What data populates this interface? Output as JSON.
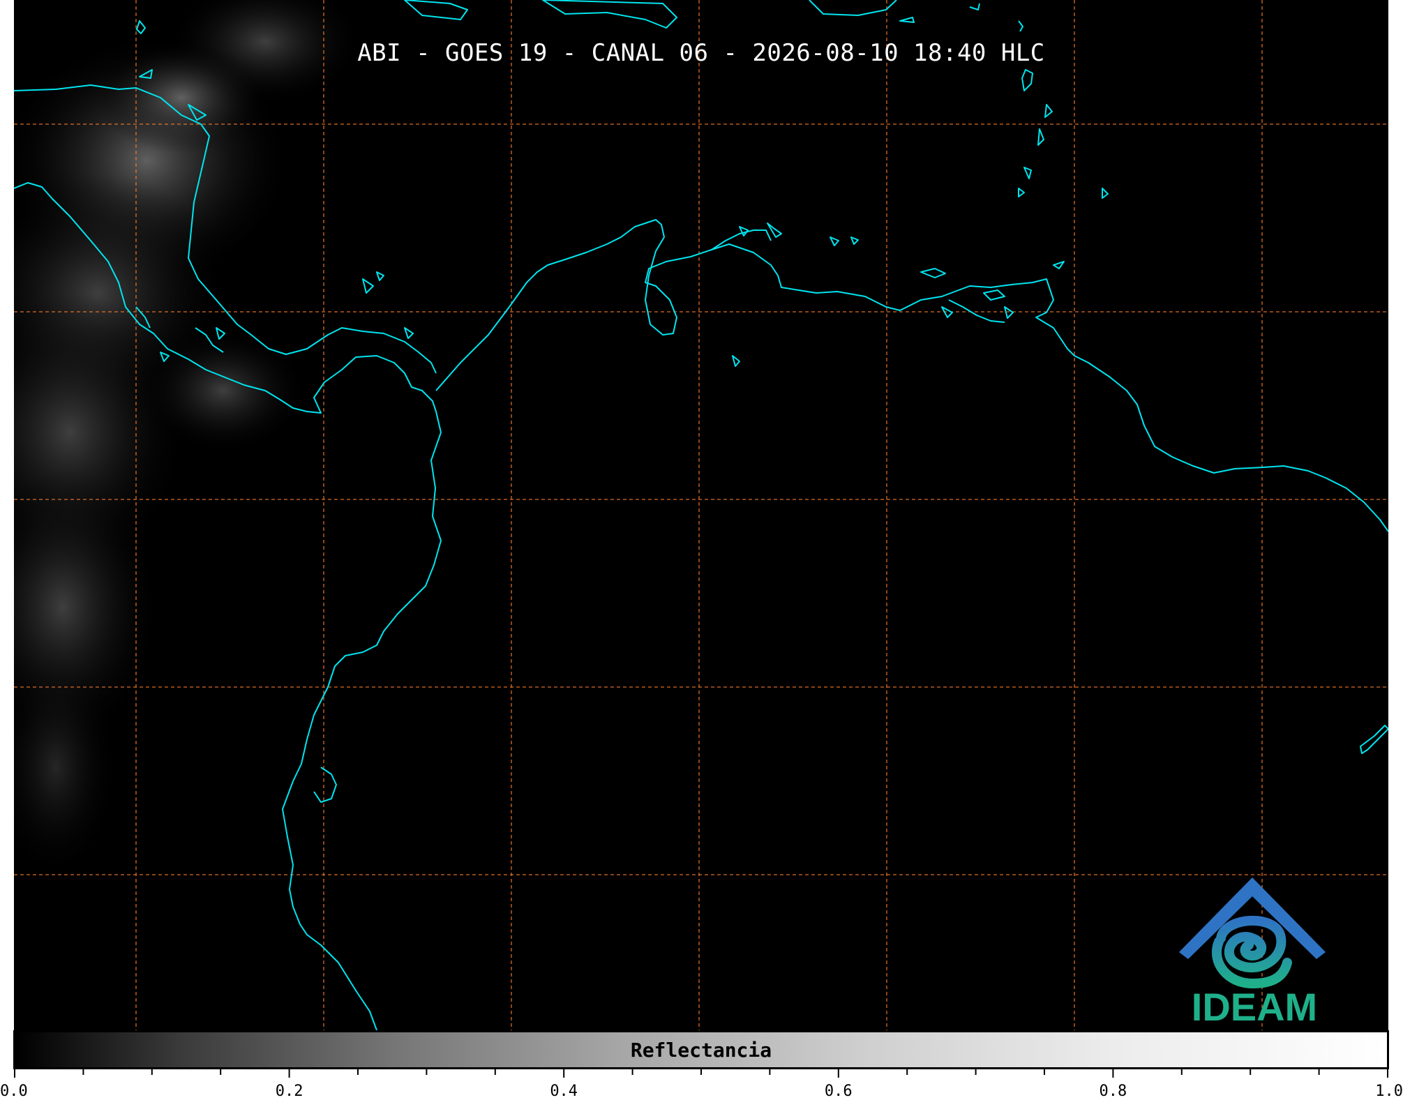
{
  "title": "ABI - GOES 19 - CANAL 06 - 2026-08-10 18:40 HLC",
  "logo": {
    "text": "IDEAM",
    "colors": [
      "#2a7ec0",
      "#1fb08a"
    ]
  },
  "colors": {
    "background": "#000000",
    "coastline": "#00e5ef",
    "gridlines": "#ff7f2a",
    "logo_blue": "#2a7ec0",
    "logo_green": "#1fb08a"
  },
  "colorbar": {
    "label": "Reflectancia",
    "min": 0.0,
    "max": 1.0,
    "tick_labels": [
      "0.0",
      "0.2",
      "0.4",
      "0.6",
      "0.8",
      "1.0"
    ],
    "colormap": "grayscale"
  },
  "gridlines": {
    "style": "dashed",
    "count_vertical": 7,
    "count_horizontal": 5
  }
}
